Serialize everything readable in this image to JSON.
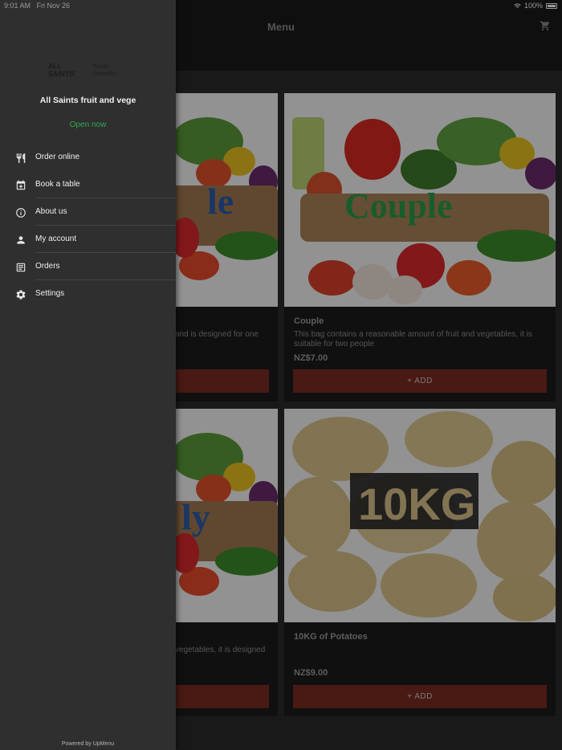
{
  "status_bar": {
    "time": "9:01 AM",
    "date": "Fri Nov 26",
    "battery": "100%"
  },
  "header": {
    "title": "Menu",
    "cart_icon": "cart-icon"
  },
  "products": [
    {
      "name": "",
      "description": "and is designed for one",
      "price": "",
      "add_label": "",
      "image_label": "le"
    },
    {
      "name": "Couple",
      "description": "This bag contains a reasonable amount of fruit and vegetables, it is suitable for two people",
      "price": "NZ$7.00",
      "add_label": "+ ADD",
      "image_label": "Couple"
    },
    {
      "name": "",
      "description": "vegetables, it is designed",
      "price": "",
      "add_label": "",
      "image_label": "ly"
    },
    {
      "name": "10KG of Potatoes",
      "description": "",
      "price": "NZ$9.00",
      "add_label": "+ ADD",
      "image_label": "10KG"
    }
  ],
  "drawer": {
    "logo_main": "ALL SAINTS'",
    "logo_sub": "North Dunedin",
    "store_name": "All Saints fruit and vege",
    "status": "Open now",
    "items": [
      {
        "label": "Order online",
        "icon": "cutlery-icon"
      },
      {
        "label": "Book a table",
        "icon": "calendar-icon"
      },
      {
        "label": "About us",
        "icon": "info-icon"
      },
      {
        "label": "My account",
        "icon": "person-icon"
      },
      {
        "label": "Orders",
        "icon": "receipt-icon"
      },
      {
        "label": "Settings",
        "icon": "gear-icon"
      }
    ],
    "footer": "Powered by UpMenu"
  },
  "colors": {
    "accent_button": "#7b2a22",
    "open_status": "#2fa84f",
    "drawer_bg": "#2f2f2f"
  }
}
